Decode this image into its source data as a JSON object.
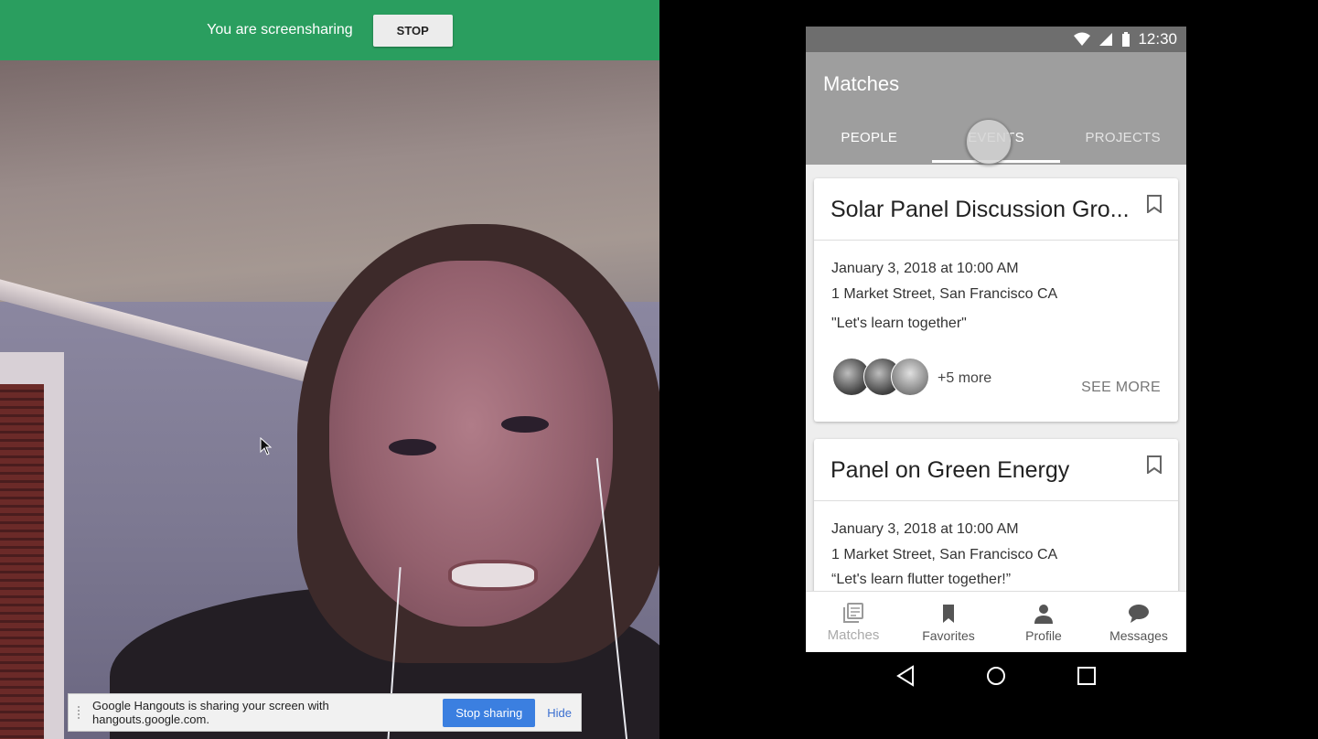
{
  "screenshare": {
    "banner_text": "You are screensharing",
    "stop_label": "STOP",
    "notification_text": "Google Hangouts is sharing your screen with hangouts.google.com.",
    "stop_sharing_label": "Stop sharing",
    "hide_label": "Hide"
  },
  "phone": {
    "status_time": "12:30",
    "app_title": "Matches",
    "tabs": [
      {
        "label": "PEOPLE",
        "selected": false
      },
      {
        "label": "EVENTS",
        "selected": true
      },
      {
        "label": "PROJECTS",
        "selected": false
      }
    ],
    "cards": [
      {
        "title": "Solar Panel Discussion Gro...",
        "date": "January 3, 2018 at 10:00 AM",
        "address": "1 Market Street, San Francisco CA",
        "quote": "\"Let's learn together\"",
        "more_attendees": "+5 more",
        "see_more_label": "SEE MORE"
      },
      {
        "title": "Panel on Green Energy",
        "date": "January 3, 2018 at 10:00 AM",
        "address": "1 Market Street, San Francisco CA",
        "quote": "“Let's learn flutter together!”"
      }
    ],
    "bottom_nav": [
      {
        "label": "Matches",
        "icon": "library-books-icon",
        "active": true
      },
      {
        "label": "Favorites",
        "icon": "bookmark-icon",
        "active": false
      },
      {
        "label": "Profile",
        "icon": "person-icon",
        "active": false
      },
      {
        "label": "Messages",
        "icon": "chat-bubble-icon",
        "active": false
      }
    ]
  },
  "colors": {
    "share_green": "#2a9e5f",
    "stop_sharing_blue": "#3b7fe0",
    "appbar_grey": "#9e9e9e",
    "statusbar_grey": "#6e6e6e"
  }
}
